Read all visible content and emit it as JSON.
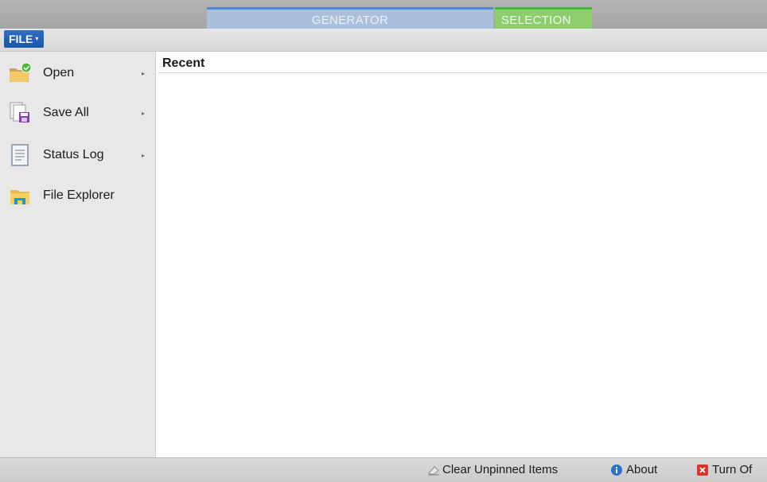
{
  "tabs": {
    "generator": "GENERATOR",
    "selection": "SELECTION"
  },
  "file_button": {
    "label": "FILE",
    "caret": "▾"
  },
  "menu": [
    {
      "label": "Open",
      "icon": "open-folder-icon",
      "has_submenu": true
    },
    {
      "label": "Save All",
      "icon": "save-all-icon",
      "has_submenu": true
    },
    {
      "label": "Status Log",
      "icon": "status-log-icon",
      "has_submenu": true
    },
    {
      "label": "File Explorer",
      "icon": "file-explorer-icon",
      "has_submenu": false
    }
  ],
  "submenu_arrow": "▸",
  "content": {
    "heading": "Recent"
  },
  "bottom": {
    "clear_label": "Clear Unpinned Items",
    "about_label": "About",
    "turnoff_label": "Turn Of"
  },
  "colors": {
    "file_button": "#1f5fb4",
    "generator_tab": "#a9bfdc",
    "selection_tab": "#8ccd6c",
    "about_icon": "#2d72c9",
    "turnoff_icon": "#d9362b"
  }
}
